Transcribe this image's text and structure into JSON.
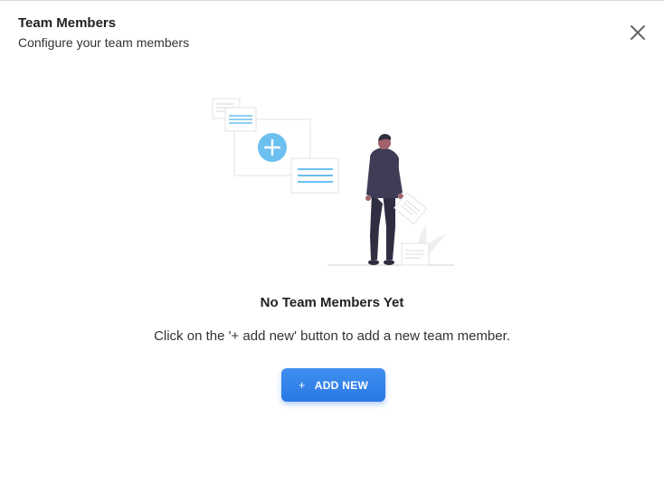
{
  "header": {
    "title": "Team Members",
    "subtitle": "Configure your team members"
  },
  "icons": {
    "close": "close-icon",
    "plus": "plus-icon",
    "illustration": "empty-state-illustration"
  },
  "empty_state": {
    "title": "No Team Members Yet",
    "message": "Click on the '+ add new' button to add a new team member."
  },
  "actions": {
    "add_new_icon": "+",
    "add_new_label": "ADD NEW"
  },
  "colors": {
    "accent": "#2a78e4",
    "illustration_blue": "#6cc0ef",
    "figure_dark": "#2f2e41"
  }
}
